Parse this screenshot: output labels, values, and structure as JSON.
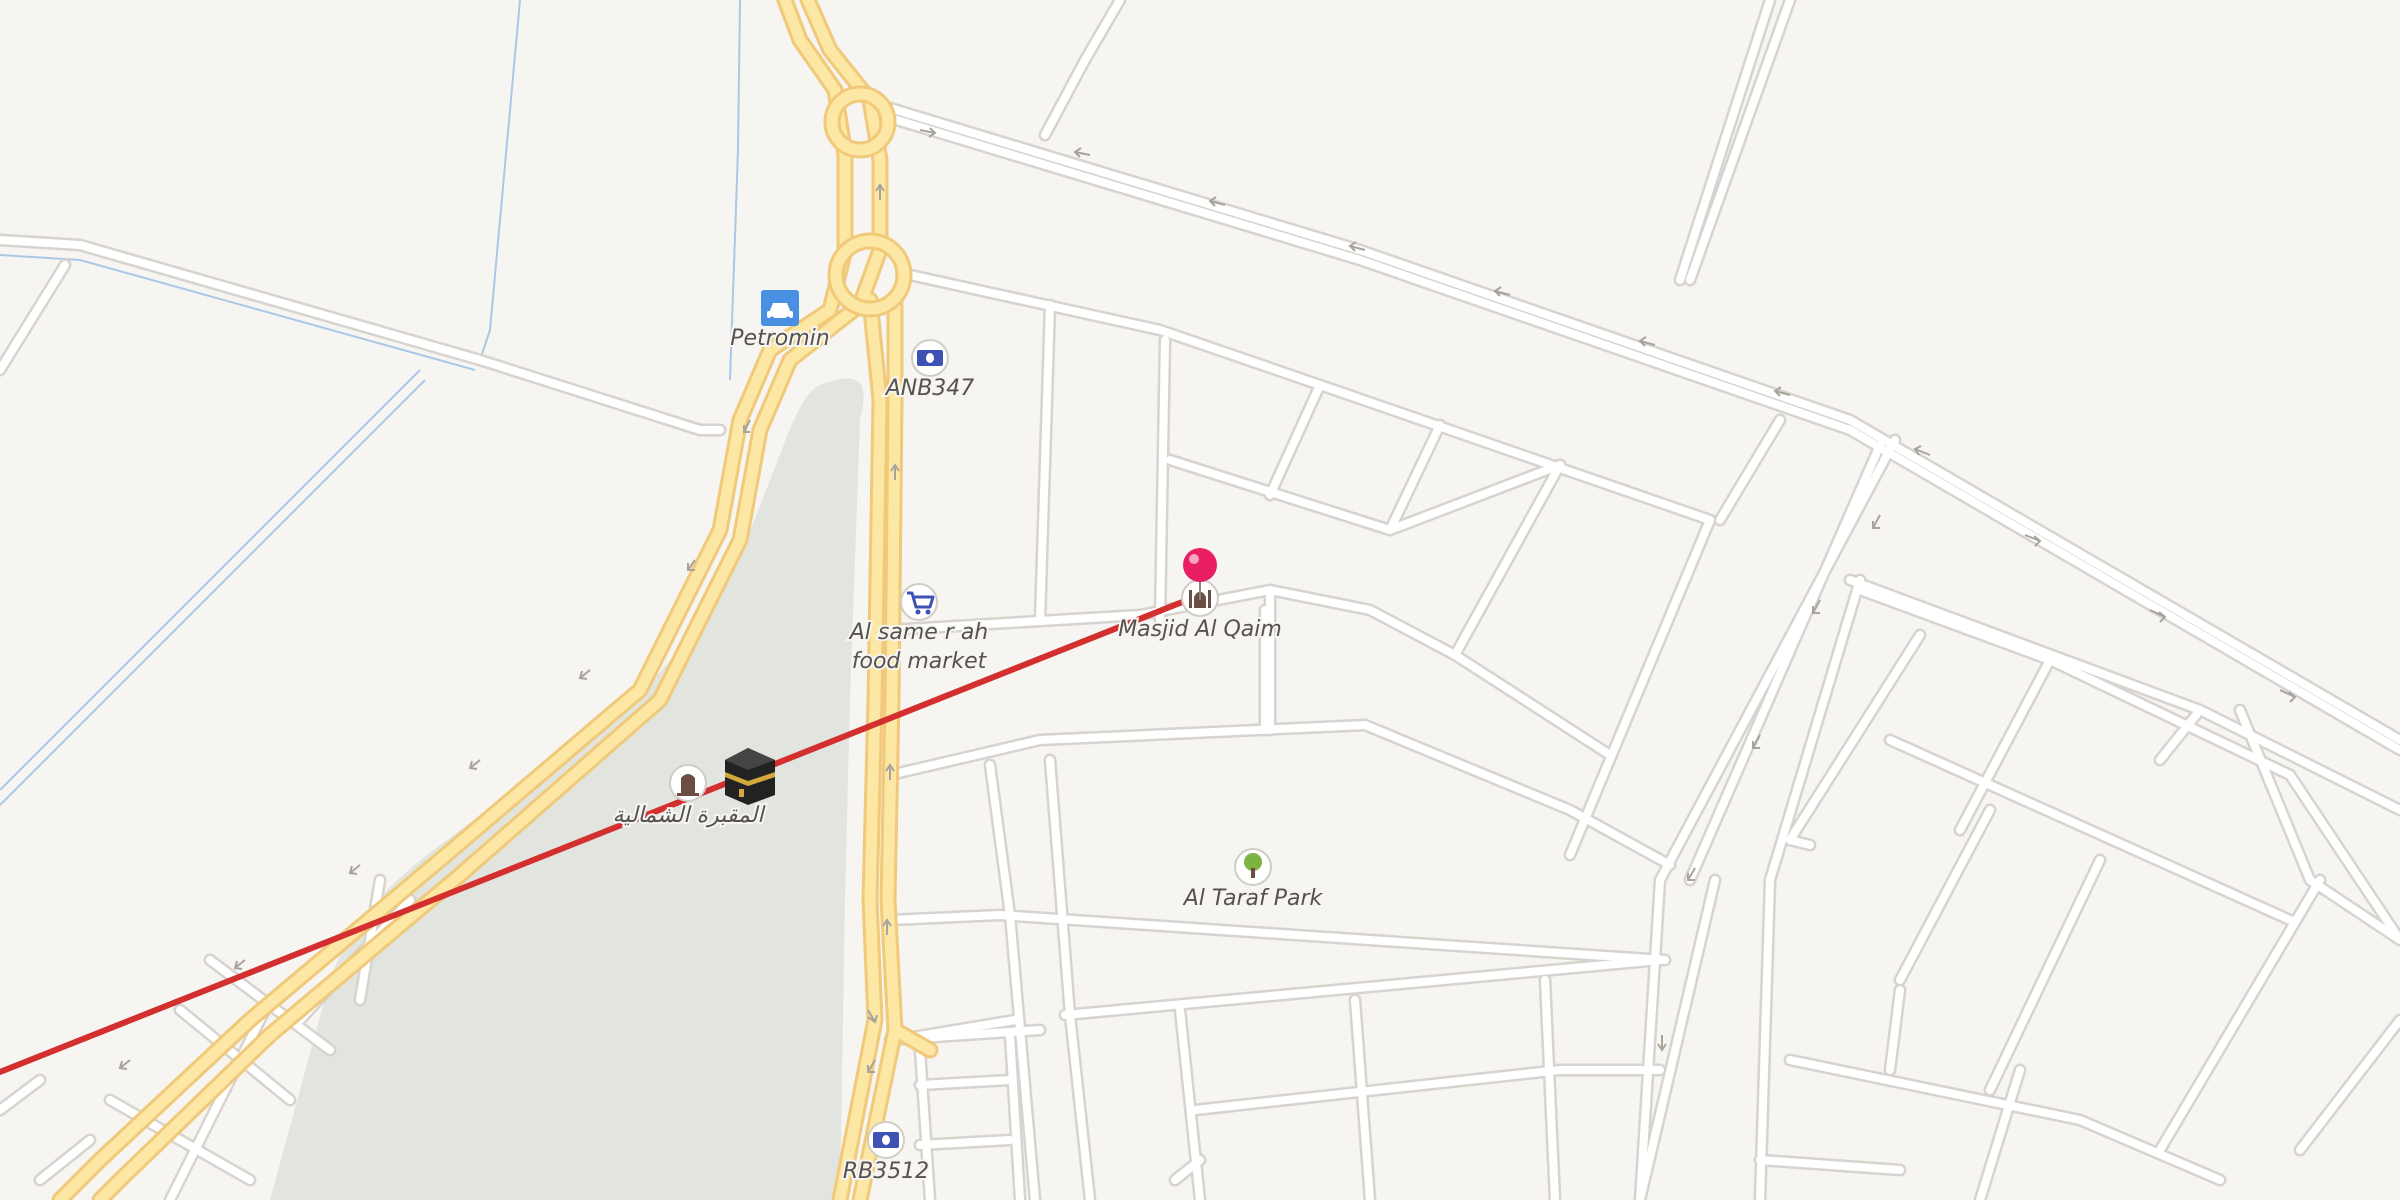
{
  "map": {
    "pois": {
      "petromin": {
        "label": "Petromin",
        "icon": "car-icon",
        "color": "#4a90e2"
      },
      "anb347": {
        "label": "ANB347",
        "icon": "banknote-icon",
        "color": "#3f51b5"
      },
      "food_market": {
        "label_line1": "Al same r ah",
        "label_line2": "food market",
        "icon": "shopping-cart-icon",
        "color": "#3f51b5"
      },
      "masjid": {
        "label": "Masjid Al Qaim",
        "icon": "mosque-icon",
        "color": "#6d4c41"
      },
      "cemetery": {
        "label": "المقبرة الشمالية",
        "icon": "tombstone-icon",
        "color": "#6d4c41"
      },
      "kaaba": {
        "icon": "kaaba-icon"
      },
      "park": {
        "label": "Al Taraf Park",
        "icon": "tree-icon",
        "color": "#7cb342"
      },
      "rb3512": {
        "label": "RB3512",
        "icon": "banknote-icon",
        "color": "#3f51b5"
      }
    },
    "marker": {
      "icon": "location-pin-icon",
      "color": "#e91e63"
    },
    "route": {
      "color": "#d32f2f"
    },
    "colors": {
      "background": "#f7f5f2",
      "road_casing": "#d7d3ce",
      "road_fill": "#ffffff",
      "highway_casing": "#f0c97a",
      "highway_fill": "#fde7a4",
      "water": "#a9c8e8",
      "green_area": "#e2e5df"
    }
  }
}
